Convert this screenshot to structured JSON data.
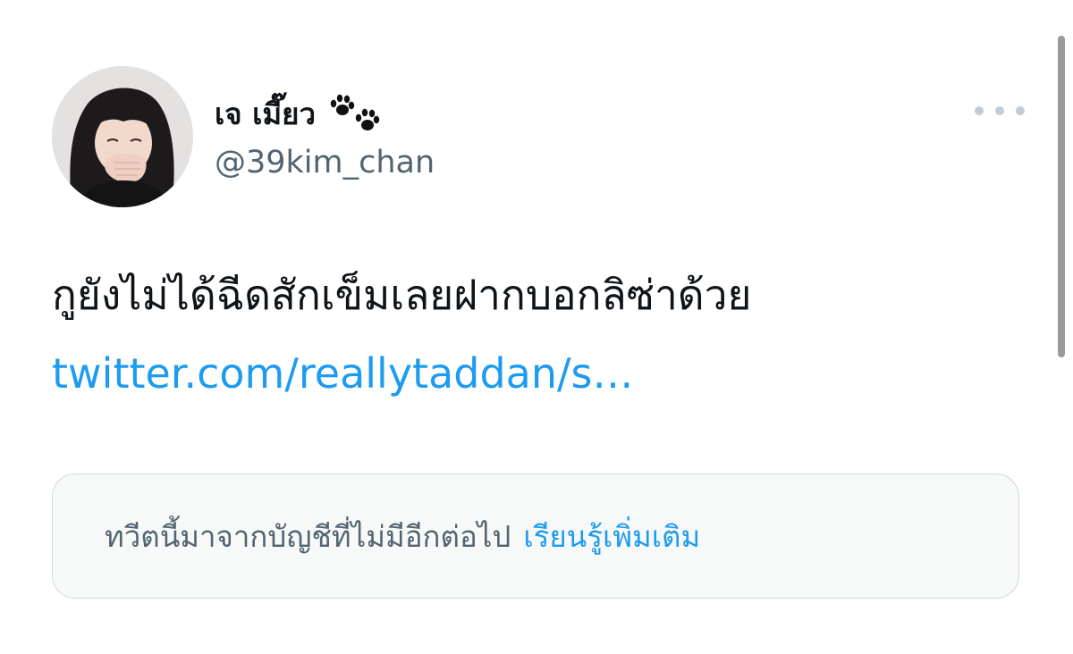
{
  "tweet": {
    "author": {
      "display_name": "เจ เมี๊ยว",
      "name_emoji_icon": "paw-prints-icon",
      "handle": "@39kim_chan"
    },
    "more_icon": "more-horizontal-icon",
    "text": "กูยังไม่ได้ฉีดสักเข็มเลยฝากบอกลิซ่าด้วย",
    "link_text": "twitter.com/reallytaddan/s…"
  },
  "notice": {
    "message": "ทวีตนี้มาจากบัญชีที่ไม่มีอีกต่อไป",
    "learn_more": "เรียนรู้เพิ่มเติม"
  },
  "colors": {
    "text_primary": "#0f1419",
    "text_secondary": "#536471",
    "link": "#1d9bf0",
    "notice_background": "#f7f9f9",
    "notice_border": "#cfd9de"
  }
}
